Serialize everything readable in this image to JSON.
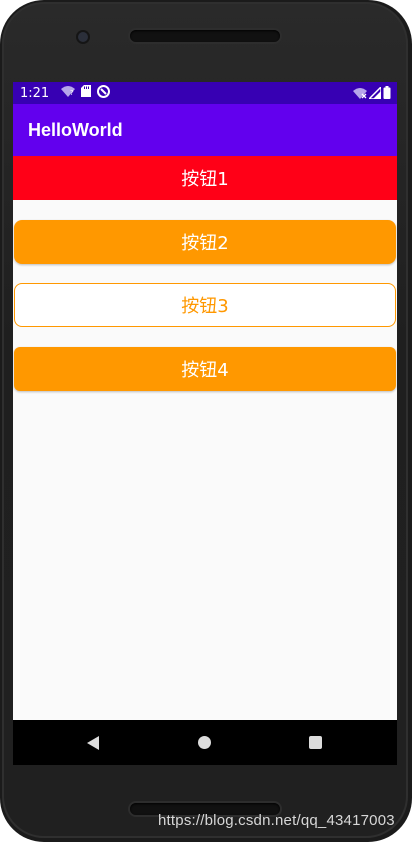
{
  "status_bar": {
    "time": "1:21",
    "left_icons": [
      "wifi-question-icon",
      "sd-card-icon",
      "sync-icon"
    ],
    "right_icons": [
      "wifi-signal-icon",
      "cell-signal-icon",
      "battery-icon"
    ],
    "background": "#3700b3"
  },
  "app_bar": {
    "title": "HelloWorld",
    "background": "#6200ee"
  },
  "buttons": [
    {
      "label": "按钮1",
      "background": "#ff0017",
      "text_color": "#ffffff"
    },
    {
      "label": "按钮2",
      "background": "#ff9800",
      "text_color": "#ffffff"
    },
    {
      "label": "按钮3",
      "background": "#ffffff",
      "text_color": "#ff9800"
    },
    {
      "label": "按钮4",
      "background": "#ff9800",
      "text_color": "#ffffff"
    }
  ],
  "nav_bar": {
    "items": [
      "back-icon",
      "home-icon",
      "recents-icon"
    ]
  },
  "watermark": "https://blog.csdn.net/qq_43417003"
}
